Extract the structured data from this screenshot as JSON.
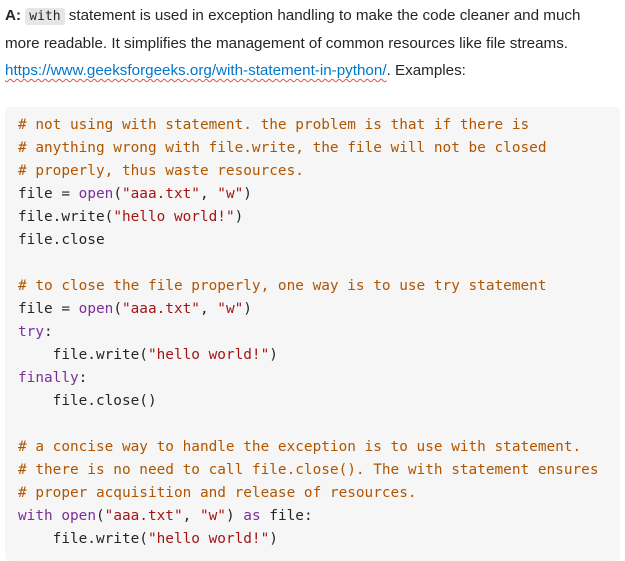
{
  "answer": {
    "label": "A:",
    "inline_code": "with",
    "text_before_link": " statement is used in exception handling to make the code cleaner and much more readable. It simplifies the management of common resources like file streams. ",
    "link_text": "https://www.geeksforgeeks.org/with-statement-in-python/",
    "text_after_link": ". Examples:"
  },
  "code": {
    "lines": [
      [
        {
          "t": "cm",
          "v": "# not using with statement. the problem is that if there is"
        }
      ],
      [
        {
          "t": "cm",
          "v": "# anything wrong with file.write, the file will not be closed"
        }
      ],
      [
        {
          "t": "cm",
          "v": "# properly, thus waste resources."
        }
      ],
      [
        {
          "t": "pl",
          "v": "file = "
        },
        {
          "t": "fn",
          "v": "open"
        },
        {
          "t": "pl",
          "v": "("
        },
        {
          "t": "st",
          "v": "\"aaa.txt\""
        },
        {
          "t": "pl",
          "v": ", "
        },
        {
          "t": "st",
          "v": "\"w\""
        },
        {
          "t": "pl",
          "v": ")"
        }
      ],
      [
        {
          "t": "pl",
          "v": "file.write("
        },
        {
          "t": "st",
          "v": "\"hello world!\""
        },
        {
          "t": "pl",
          "v": ")"
        }
      ],
      [
        {
          "t": "pl",
          "v": "file.close"
        }
      ],
      [],
      [
        {
          "t": "cm",
          "v": "# to close the file properly, one way is to use try statement"
        }
      ],
      [
        {
          "t": "pl",
          "v": "file = "
        },
        {
          "t": "fn",
          "v": "open"
        },
        {
          "t": "pl",
          "v": "("
        },
        {
          "t": "st",
          "v": "\"aaa.txt\""
        },
        {
          "t": "pl",
          "v": ", "
        },
        {
          "t": "st",
          "v": "\"w\""
        },
        {
          "t": "pl",
          "v": ")"
        }
      ],
      [
        {
          "t": "kw",
          "v": "try"
        },
        {
          "t": "pl",
          "v": ":"
        }
      ],
      [
        {
          "t": "pl",
          "v": "    file.write("
        },
        {
          "t": "st",
          "v": "\"hello world!\""
        },
        {
          "t": "pl",
          "v": ")"
        }
      ],
      [
        {
          "t": "kw",
          "v": "finally"
        },
        {
          "t": "pl",
          "v": ":"
        }
      ],
      [
        {
          "t": "pl",
          "v": "    file.close()"
        }
      ],
      [],
      [
        {
          "t": "cm",
          "v": "# a concise way to handle the exception is to use with statement."
        }
      ],
      [
        {
          "t": "cm",
          "v": "# there is no need to call file.close(). The with statement ensures"
        }
      ],
      [
        {
          "t": "cm",
          "v": "# proper acquisition and release of resources."
        }
      ],
      [
        {
          "t": "kw",
          "v": "with"
        },
        {
          "t": "pl",
          "v": " "
        },
        {
          "t": "fn",
          "v": "open"
        },
        {
          "t": "pl",
          "v": "("
        },
        {
          "t": "st",
          "v": "\"aaa.txt\""
        },
        {
          "t": "pl",
          "v": ", "
        },
        {
          "t": "st",
          "v": "\"w\""
        },
        {
          "t": "pl",
          "v": ") "
        },
        {
          "t": "kw",
          "v": "as"
        },
        {
          "t": "pl",
          "v": " file:"
        }
      ],
      [
        {
          "t": "pl",
          "v": "    file.write("
        },
        {
          "t": "st",
          "v": "\"hello world!\""
        },
        {
          "t": "pl",
          "v": ")"
        }
      ]
    ]
  }
}
